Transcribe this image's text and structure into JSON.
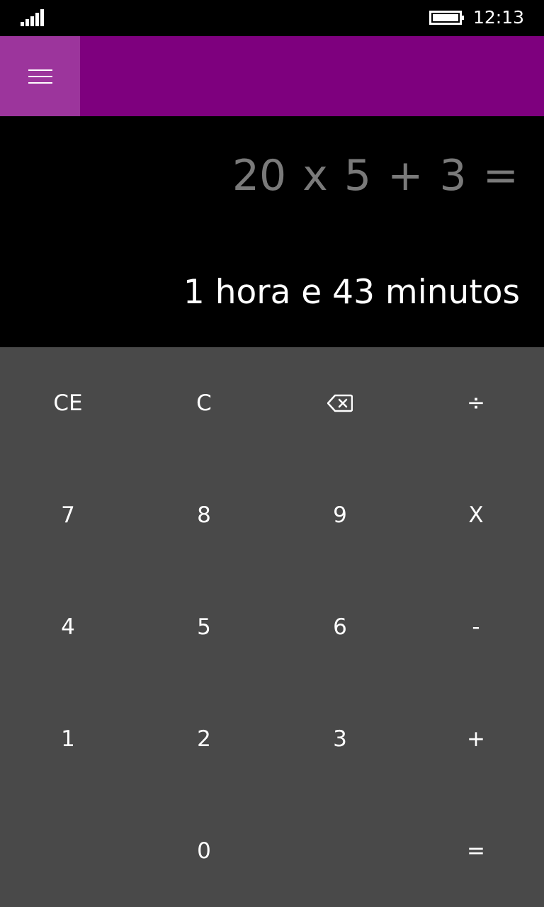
{
  "status_bar": {
    "signal_icon": "signal-strength-icon",
    "battery_icon": "battery-icon",
    "time": "12:13"
  },
  "header": {
    "menu_icon": "hamburger-menu-icon",
    "accent_color": "#7e007e",
    "menu_button_color": "#9c359c"
  },
  "display": {
    "expression": "20 x 5 + 3 =",
    "result": "1 hora e 43 minutos"
  },
  "keypad": {
    "background": "#494949",
    "keys": [
      {
        "label": "CE"
      },
      {
        "label": "C"
      },
      {
        "label": "",
        "icon": "backspace-icon"
      },
      {
        "label": "÷"
      },
      {
        "label": "7"
      },
      {
        "label": "8"
      },
      {
        "label": "9"
      },
      {
        "label": "X"
      },
      {
        "label": "4"
      },
      {
        "label": "5"
      },
      {
        "label": "6"
      },
      {
        "label": "-"
      },
      {
        "label": "1"
      },
      {
        "label": "2"
      },
      {
        "label": "3"
      },
      {
        "label": "+"
      },
      {
        "label": ""
      },
      {
        "label": "0"
      },
      {
        "label": ""
      },
      {
        "label": "="
      }
    ]
  }
}
